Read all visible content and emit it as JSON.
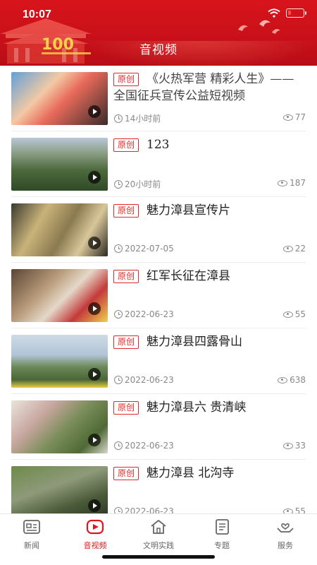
{
  "status_bar": {
    "time": "10:07",
    "battery_percent": 20
  },
  "header": {
    "title": "音视频"
  },
  "videos": [
    {
      "tag": "原创",
      "title": "《火热军营  精彩人生》——  全国征兵宣传公益短视频",
      "time": "14小时前",
      "views": "77"
    },
    {
      "tag": "原创",
      "title": "123",
      "time": "20小时前",
      "views": "187"
    },
    {
      "tag": "原创",
      "title": "魅力漳县宣传片",
      "time": "2022-07-05",
      "views": "22"
    },
    {
      "tag": "原创",
      "title": "红军长征在漳县",
      "time": "2022-06-23",
      "views": "55"
    },
    {
      "tag": "原创",
      "title": "魅力漳县四露骨山",
      "time": "2022-06-23",
      "views": "638"
    },
    {
      "tag": "原创",
      "title": "魅力漳县六  贵清峡",
      "time": "2022-06-23",
      "views": "33"
    },
    {
      "tag": "原创",
      "title": "魅力漳县  北沟寺",
      "time": "2022-06-23",
      "views": "55"
    }
  ],
  "bottom_nav": [
    {
      "label": "新闻",
      "icon": "news-icon",
      "active": false
    },
    {
      "label": "音视频",
      "icon": "video-play-icon",
      "active": true
    },
    {
      "label": "文明实践",
      "icon": "home-icon",
      "active": false
    },
    {
      "label": "专题",
      "icon": "topic-icon",
      "active": false
    },
    {
      "label": "服务",
      "icon": "service-hands-icon",
      "active": false
    }
  ],
  "colors": {
    "brand_red": "#d8141b",
    "tag_red": "#e22a2a",
    "active_nav": "#e0161d"
  }
}
